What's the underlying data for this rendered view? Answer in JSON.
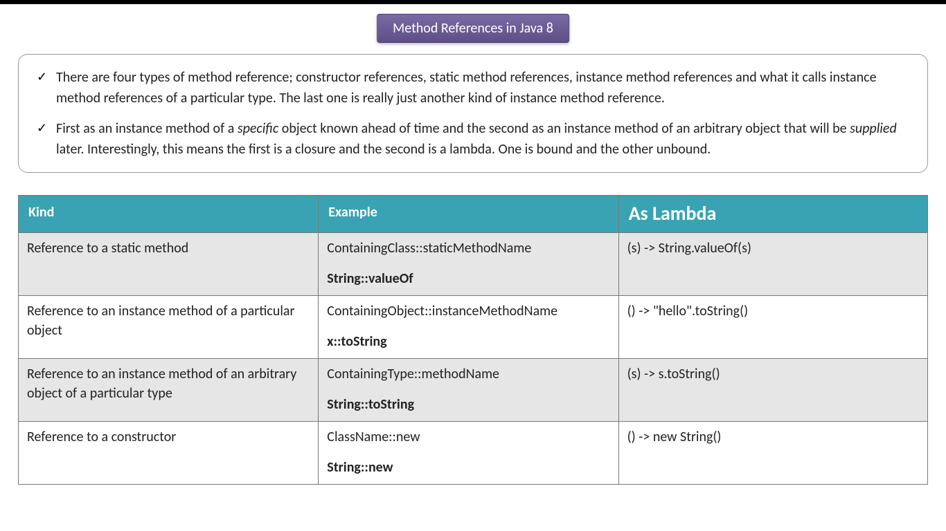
{
  "title": "Method References in Java 8",
  "bullets": [
    {
      "pre": "There are four types of method reference; constructor references, static method references, instance method references and what it calls instance method references of a particular type. The last one is really just another kind of instance method reference.",
      "em1": "",
      "mid": "",
      "em2": "",
      "post": ""
    },
    {
      "pre": "First as an instance method of a ",
      "em1": "specific",
      "mid": " object known ahead of time and the second as an instance method of an arbitrary object that will be ",
      "em2": "supplied",
      "post": " later. Interestingly, this means the first is a closure and the second is a lambda. One is bound and the other unbound."
    }
  ],
  "table": {
    "headers": {
      "kind": "Kind",
      "example": "Example",
      "lambda": "As Lambda"
    },
    "rows": [
      {
        "kind": "Reference to a static method",
        "example_main": "ContainingClass::staticMethodName",
        "example_bold": "String::valueOf",
        "lambda": "(s) -> String.valueOf(s)"
      },
      {
        "kind": "Reference to an instance method of a particular object",
        "example_main": "ContainingObject::instanceMethodName",
        "example_bold": "x::toString",
        "lambda": "() -> \"hello\".toString()"
      },
      {
        "kind": "Reference to an instance method of an arbitrary object of a particular type",
        "example_main": "ContainingType::methodName",
        "example_bold": "String::toString",
        "lambda": "(s) -> s.toString()"
      },
      {
        "kind": "Reference to a constructor",
        "example_main": "ClassName::new",
        "example_bold": "String::new",
        "lambda": "() -> new String()"
      }
    ]
  }
}
